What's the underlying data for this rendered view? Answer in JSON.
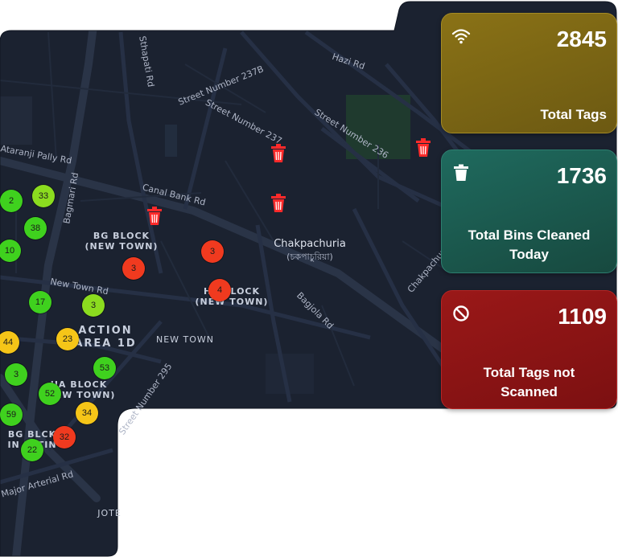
{
  "map": {
    "roads": [
      "Street Number 237B",
      "Street Number 237",
      "Street Number 236",
      "Hazi Rd",
      "Canal Bank Rd",
      "New Town Rd",
      "Ataranji Pally Rd",
      "Street Number 295",
      "Major Arterial Rd",
      "Bagmari Rd",
      "Chakpachuria Rd",
      "Bagjola Rd",
      "Sthapati Rd"
    ],
    "areas": [
      "BG BLOCK\n(NEW TOWN)",
      "HC BLOCK\n(NEW TOWN)",
      "ACTION\nAREA 1D",
      "NEW TOWN",
      "IIA BLOCK\n(NEW TOWN)",
      "BG BLCK\nIN EATIN",
      "JOTE"
    ],
    "place_name": "Chakpachuria",
    "place_name_local": "(চকপাচুরিয়া)",
    "markers": [
      {
        "value": "2",
        "status": "green"
      },
      {
        "value": "33",
        "status": "green"
      },
      {
        "value": "38",
        "status": "green"
      },
      {
        "value": "10",
        "status": "green"
      },
      {
        "value": "17",
        "status": "green"
      },
      {
        "value": "3",
        "status": "green"
      },
      {
        "value": "44",
        "status": "yellow"
      },
      {
        "value": "23",
        "status": "yellow"
      },
      {
        "value": "3",
        "status": "green"
      },
      {
        "value": "53",
        "status": "green"
      },
      {
        "value": "52",
        "status": "green"
      },
      {
        "value": "59",
        "status": "green"
      },
      {
        "value": "34",
        "status": "yellow"
      },
      {
        "value": "22",
        "status": "green"
      },
      {
        "value": "32",
        "status": "red"
      },
      {
        "value": "3",
        "status": "red"
      },
      {
        "value": "3",
        "status": "red"
      },
      {
        "value": "4",
        "status": "red"
      }
    ],
    "bin_icon": "trash-bin-icon",
    "colors": {
      "green": "#3fd11e",
      "lime": "#8bdc1f",
      "yellow": "#f5c518",
      "red": "#f03a1f",
      "background": "#1b2230"
    }
  },
  "cards": {
    "total_tags": {
      "value": "2845",
      "label": "Total Tags",
      "icon": "wifi-icon",
      "color": "#7b6516"
    },
    "bins_cleaned": {
      "value": "1736",
      "label": "Total Bins Cleaned Today",
      "icon": "trash-icon",
      "color": "#1c5b52"
    },
    "tags_not_scanned": {
      "value": "1109",
      "label": "Total Tags not Scanned",
      "icon": "blocked-icon",
      "color": "#8c1416"
    }
  }
}
